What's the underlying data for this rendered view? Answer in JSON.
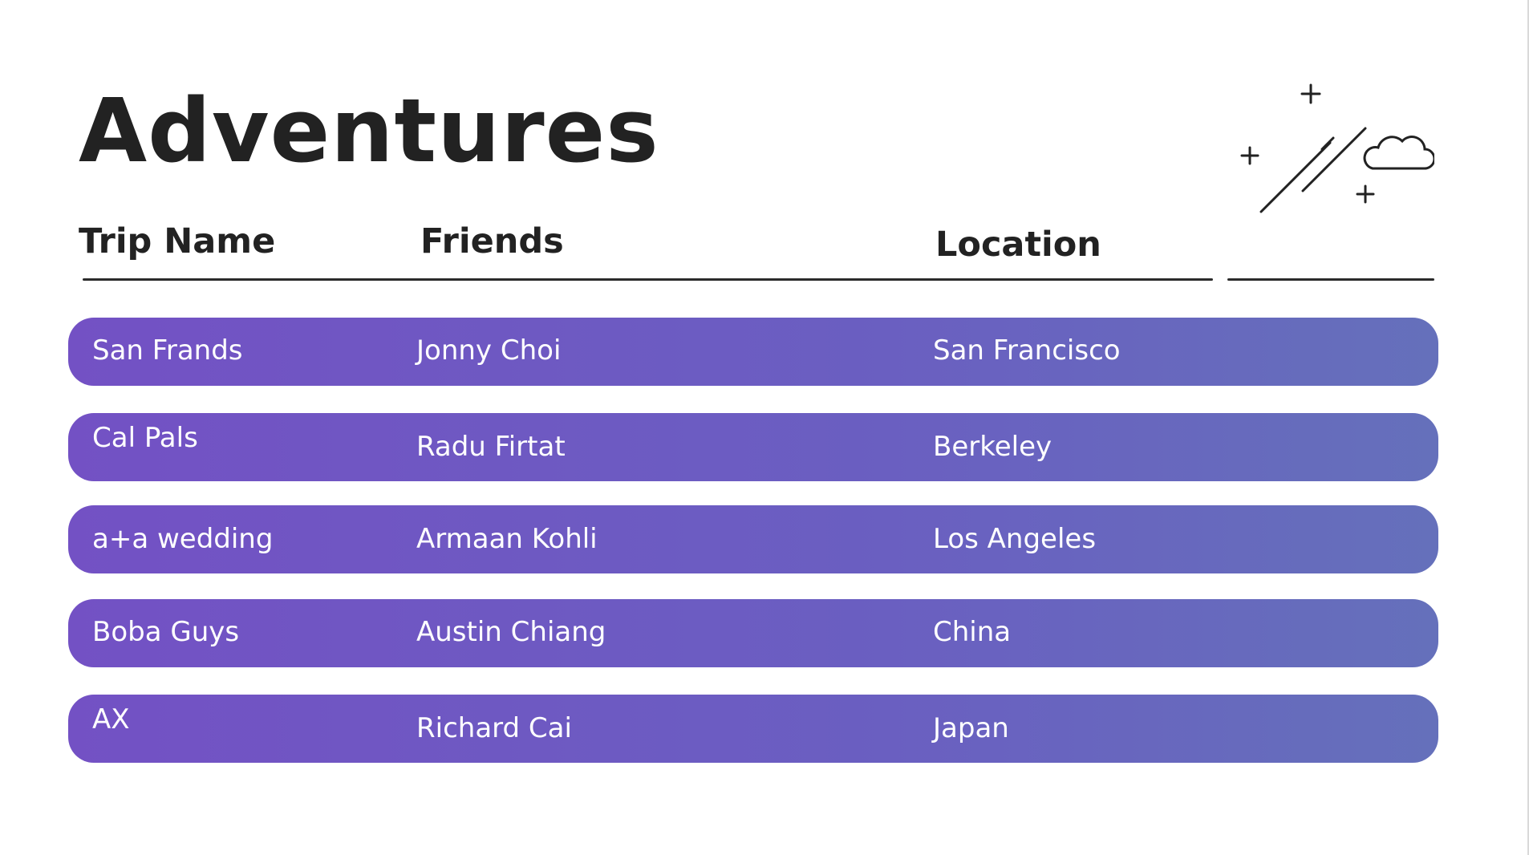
{
  "page": {
    "title": "Adventures"
  },
  "columns": {
    "trip_name": "Trip Name",
    "friends": "Friends",
    "location": "Location"
  },
  "decoration": {
    "icon": "shooting-star-cloud-icon"
  },
  "colors": {
    "row_gradient_start": "#7351c4",
    "row_gradient_end": "#6570bb",
    "title": "#222222"
  },
  "trips": [
    {
      "name": "San Frands",
      "friend": "Jonny Choi",
      "location": "San Francisco"
    },
    {
      "name": "Cal Pals",
      "friend": "Radu Firtat",
      "location": "Berkeley"
    },
    {
      "name": "a+a wedding",
      "friend": "Armaan Kohli",
      "location": "Los Angeles"
    },
    {
      "name": "Boba Guys",
      "friend": "Austin Chiang",
      "location": "China"
    },
    {
      "name": "AX",
      "friend": "Richard Cai",
      "location": "Japan"
    }
  ]
}
